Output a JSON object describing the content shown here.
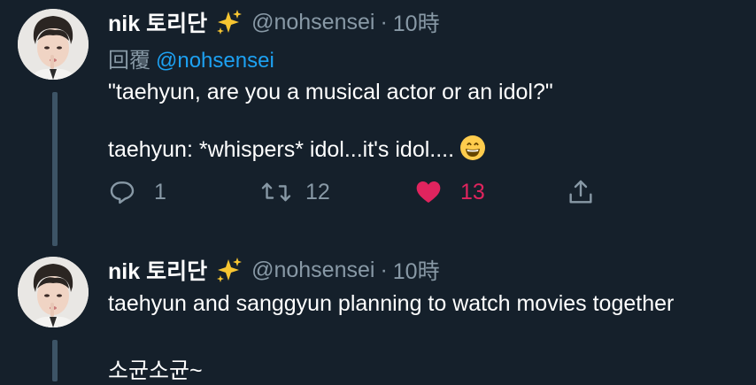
{
  "tweets": [
    {
      "author_name": "nik 토리단",
      "handle": "@nohsensei",
      "separator": "·",
      "time": "10時",
      "reply_label": "回覆",
      "reply_to": "@nohsensei",
      "text_line1": "\"taehyun, are you a musical actor or an idol?\"",
      "text_line2": "taehyun: *whispers* idol...it's idol....",
      "actions": {
        "reply_count": "1",
        "retweet_count": "12",
        "like_count": "13",
        "liked": true
      },
      "icons": [
        "avatar-photo",
        "sparkles-icon",
        "grinning-emoji",
        "reply-icon",
        "retweet-icon",
        "heart-icon",
        "share-icon"
      ]
    },
    {
      "author_name": "nik 토리단",
      "handle": "@nohsensei",
      "separator": "·",
      "time": "10時",
      "text_line1": "taehyun and sanggyun planning to watch movies together",
      "text_line2": "소균소균~"
    }
  ],
  "colors": {
    "background": "#15202b",
    "secondary_text": "#8899a6",
    "link": "#1da1f2",
    "like": "#e0245e",
    "thread_line": "#3d5466"
  }
}
